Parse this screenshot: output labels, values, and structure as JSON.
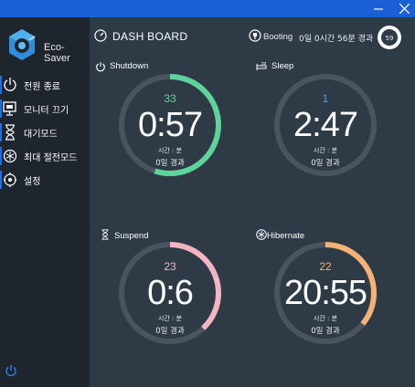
{
  "window": {
    "minimize_icon": "minimize-icon",
    "close_icon": "close-icon"
  },
  "app": {
    "name": "Eco-Saver"
  },
  "sidebar": {
    "items": [
      {
        "label": "전원 종료",
        "icon": "power-icon"
      },
      {
        "label": "모니터 끄기",
        "icon": "monitor-icon"
      },
      {
        "label": "대기모드",
        "icon": "hourglass-icon"
      },
      {
        "label": "최대 절전모드",
        "icon": "snowflake-icon"
      },
      {
        "label": "설정",
        "icon": "settings-icon"
      }
    ],
    "footer_icon": "power-icon"
  },
  "header": {
    "title": "DASH BOARD",
    "booting_label": "Booting",
    "booting_value": "0일 0시간 56분 경과",
    "booting_gauge": "59"
  },
  "cards": [
    {
      "label": "Shutdown",
      "count": "33",
      "time": "0:57",
      "unit": "시간 : 분",
      "elapsed": "0일 경과",
      "progress": 0.55,
      "color": "#5ed39c",
      "icon": "power-icon"
    },
    {
      "label": "Sleep",
      "count": "1",
      "time": "2:47",
      "unit": "시간 : 분",
      "elapsed": "0일 경과",
      "progress": 0.0,
      "color": "#4f9be8",
      "icon": "sleep-bed-icon"
    },
    {
      "label": "Suspend",
      "count": "23",
      "time": "0:6",
      "unit": "시간 : 분",
      "elapsed": "0일 경과",
      "progress": 0.38,
      "color": "#f3b5bf",
      "icon": "hourglass-icon"
    },
    {
      "label": "Hibernate",
      "count": "22",
      "time": "20:55",
      "unit": "시간 : 분",
      "elapsed": "0일 경과",
      "progress": 0.36,
      "color": "#f5b274",
      "icon": "snowflake-icon"
    }
  ]
}
